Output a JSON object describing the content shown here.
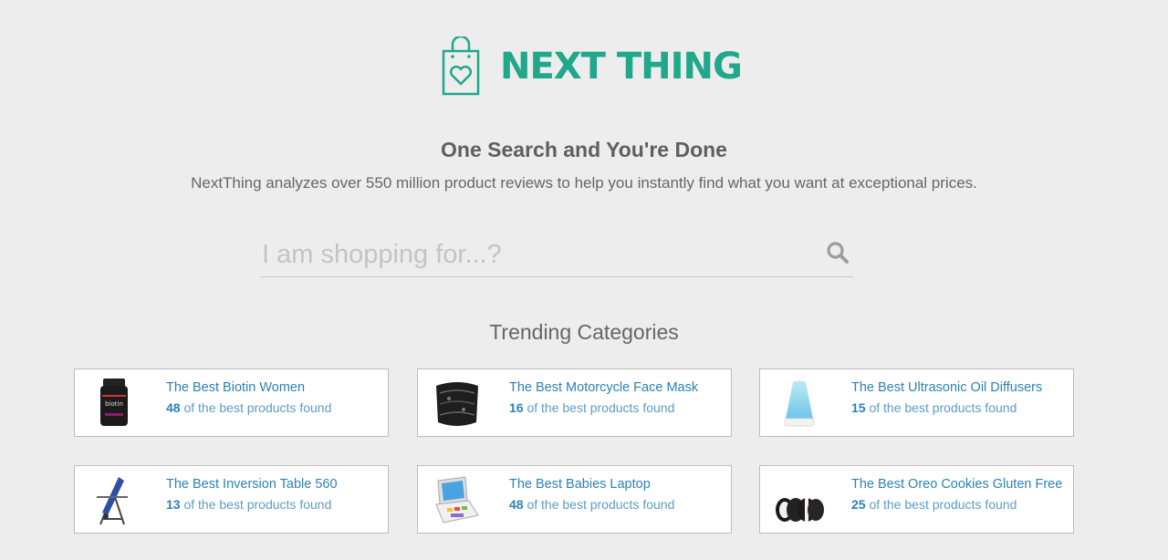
{
  "brand": {
    "name": "NEXT THING",
    "color": "#1fa88a"
  },
  "hero": {
    "headline": "One Search and You're Done",
    "subline": "NextThing analyzes over 550 million product reviews to help you instantly find what you want at exceptional prices."
  },
  "search": {
    "placeholder": "I am shopping for...?",
    "value": "",
    "icon": "search-icon"
  },
  "trending": {
    "heading": "Trending Categories",
    "count_suffix": "of the best products found",
    "cards": [
      {
        "title": "The Best Biotin Women",
        "count": "48",
        "image": "biotin-bottle"
      },
      {
        "title": "The Best Motorcycle Face Mask",
        "count": "16",
        "image": "face-mask"
      },
      {
        "title": "The Best Ultrasonic Oil Diffusers",
        "count": "15",
        "image": "oil-diffuser"
      },
      {
        "title": "The Best Inversion Table 560",
        "count": "13",
        "image": "inversion-table"
      },
      {
        "title": "The Best Babies Laptop",
        "count": "48",
        "image": "toy-laptop"
      },
      {
        "title": "The Best Oreo Cookies Gluten Free",
        "count": "25",
        "image": "oreo-cookies"
      }
    ]
  },
  "colors": {
    "background": "#ededed",
    "link": "#2b82b4",
    "text": "#5f5f5f"
  }
}
